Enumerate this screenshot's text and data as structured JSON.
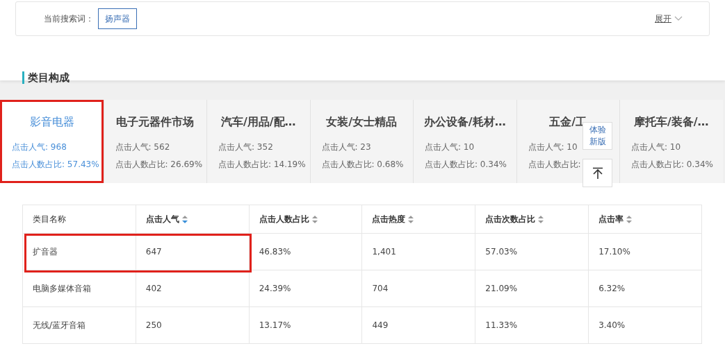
{
  "search_bar": {
    "label": "当前搜索词：",
    "keyword": "扬声器",
    "expand": "展开"
  },
  "section_title": "类目构成",
  "categories": [
    {
      "name": "影音电器",
      "clicks": "点击人气: 968",
      "ratio": "点击人数占比: 57.43%",
      "selected": true,
      "highlighted": true
    },
    {
      "name": "电子元器件市场",
      "clicks": "点击人气: 562",
      "ratio": "点击人数占比: 26.69%",
      "selected": false,
      "highlighted": false
    },
    {
      "name": "汽车/用品/配…",
      "clicks": "点击人气: 352",
      "ratio": "点击人数占比: 14.19%",
      "selected": false,
      "highlighted": false
    },
    {
      "name": "女装/女士精品",
      "clicks": "点击人气: 23",
      "ratio": "点击人数占比: 0.68%",
      "selected": false,
      "highlighted": false
    },
    {
      "name": "办公设备/耗材…",
      "clicks": "点击人气: 10",
      "ratio": "点击人数占比: 0.34%",
      "selected": false,
      "highlighted": false
    },
    {
      "name": "五金/工",
      "clicks": "点击人气: 10",
      "ratio": "点击人数占比:",
      "selected": false,
      "highlighted": false
    },
    {
      "name": "摩托车/装备/…",
      "clicks": "点击人气: 10",
      "ratio": "点击人数占比: 0.34%",
      "selected": false,
      "highlighted": false
    }
  ],
  "floating_buttons": {
    "new_version": "体验新版"
  },
  "table": {
    "columns": [
      {
        "label": "类目名称"
      },
      {
        "label": "点击人气",
        "sorted": true
      },
      {
        "label": "点击人数占比",
        "sorted": false
      },
      {
        "label": "点击热度",
        "sorted": false
      },
      {
        "label": "点击次数占比",
        "sorted": false
      },
      {
        "label": "点击率",
        "sorted": false
      }
    ],
    "rows": [
      {
        "cells": [
          "扩音器",
          "647",
          "46.83%",
          "1,401",
          "57.03%",
          "17.10%"
        ],
        "highlighted": true
      },
      {
        "cells": [
          "电脑多媒体音箱",
          "402",
          "24.39%",
          "704",
          "21.09%",
          "6.32%"
        ],
        "highlighted": false
      },
      {
        "cells": [
          "无线/蓝牙音箱",
          "250",
          "13.17%",
          "449",
          "11.33%",
          "3.40%"
        ],
        "highlighted": false
      }
    ]
  }
}
